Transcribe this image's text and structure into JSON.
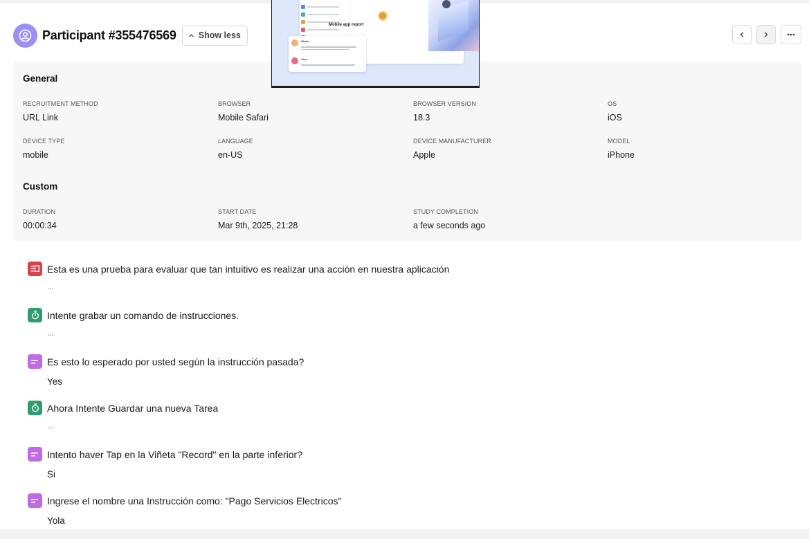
{
  "header": {
    "title": "Participant #355476569",
    "show_less_label": "Show less"
  },
  "general": {
    "title": "General",
    "fields": [
      {
        "label": "RECRUITMENT METHOD",
        "value": "URL Link"
      },
      {
        "label": "BROWSER",
        "value": "Mobile Safari"
      },
      {
        "label": "BROWSER VERSION",
        "value": "18.3"
      },
      {
        "label": "OS",
        "value": "iOS"
      },
      {
        "label": "DEVICE TYPE",
        "value": "mobile"
      },
      {
        "label": "LANGUAGE",
        "value": "en-US"
      },
      {
        "label": "DEVICE MANUFACTURER",
        "value": "Apple"
      },
      {
        "label": "MODEL",
        "value": "iPhone"
      }
    ]
  },
  "custom": {
    "title": "Custom",
    "fields": [
      {
        "label": "DURATION",
        "value": "00:00:34"
      },
      {
        "label": "START DATE",
        "value": "Mar 9th, 2025, 21:28"
      },
      {
        "label": "STUDY COMPLETION",
        "value": "a few seconds ago"
      }
    ]
  },
  "preview": {
    "report_title": "Mobile app report",
    "chat_names": [
      "Olivia",
      "Jane"
    ]
  },
  "timeline": [
    {
      "type": "context",
      "color": "#d8434b",
      "icon": "context-screen-icon",
      "question": "Esta es una prueba para evaluar que tan intuitivo es realizar una acción en nuestra aplicación",
      "answer": "..."
    },
    {
      "type": "task",
      "color": "#2f9e6e",
      "icon": "stopwatch-icon",
      "question": "Intente grabar un comando de instrucciones.",
      "answer": "..."
    },
    {
      "type": "question",
      "color": "#c06ae6",
      "icon": "text-lines-icon",
      "question": "Es esto lo esperado por usted según la instrucción pasada?",
      "answer": "Yes"
    },
    {
      "type": "task",
      "color": "#2f9e6e",
      "icon": "stopwatch-icon",
      "question": "Ahora Intente Guardar una nueva Tarea",
      "answer": "..."
    },
    {
      "type": "question",
      "color": "#c06ae6",
      "icon": "text-lines-icon",
      "question": "Intento haver Tap en la Viñeta \"Record\" en la parte inferior?",
      "answer": "Si"
    },
    {
      "type": "question",
      "color": "#c06ae6",
      "icon": "text-lines-icon",
      "question": "Ingrese el nombre una Instrucción como: \"Pago Servicios Electricos\"",
      "answer": "Yola"
    }
  ],
  "colors": {
    "avatar": "#9b91f5",
    "panel_bg": "#f7f7f8",
    "context": "#d8434b",
    "task": "#2f9e6e",
    "question": "#c06ae6"
  }
}
